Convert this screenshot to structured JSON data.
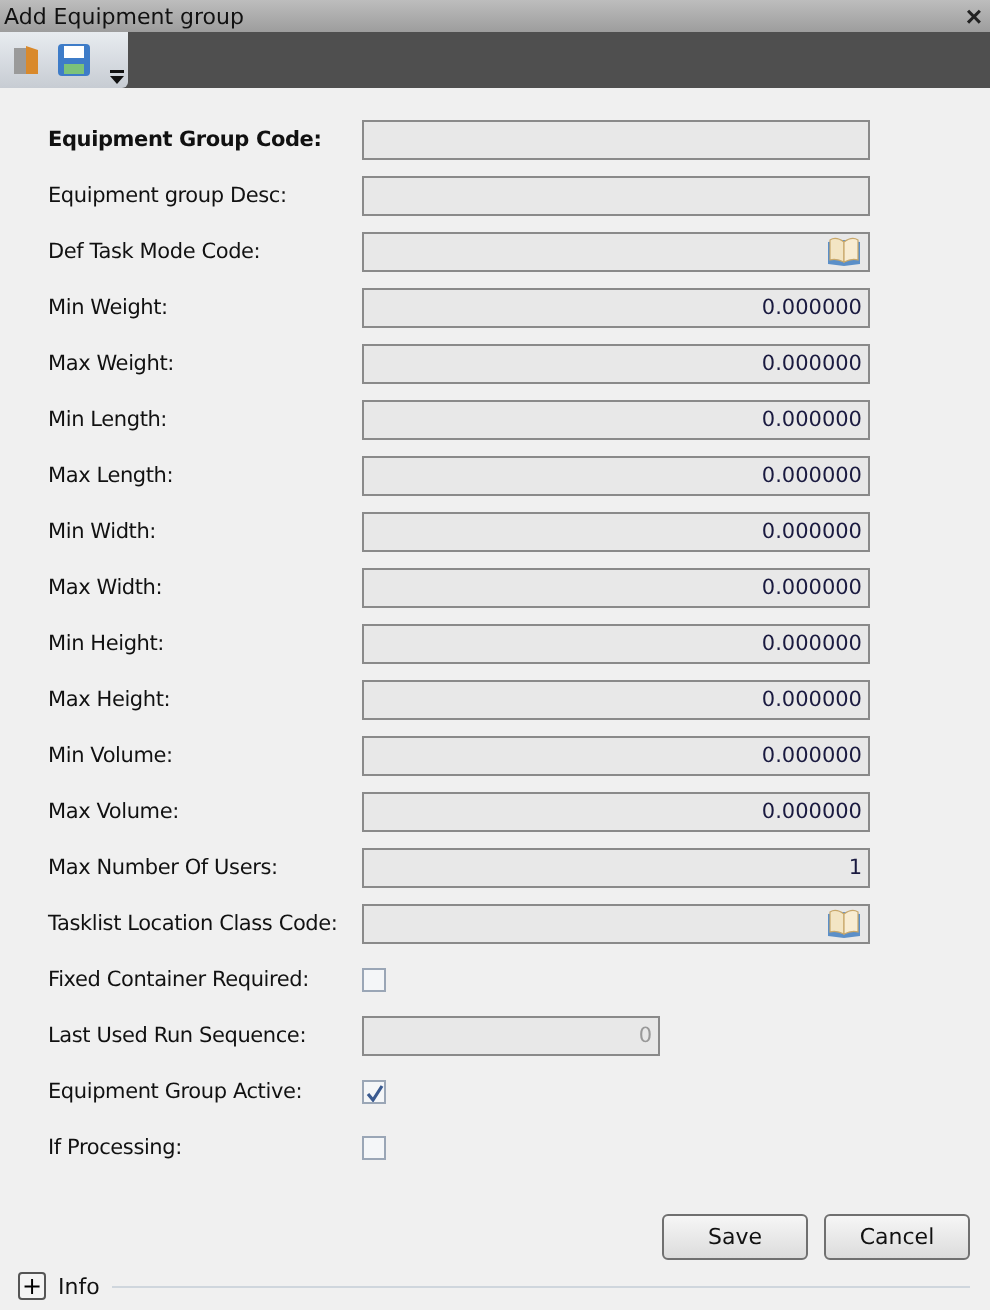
{
  "window": {
    "title": "Add Equipment group",
    "close": "×"
  },
  "fields": [
    {
      "label": "Equipment Group Code:",
      "required": true,
      "kind": "text"
    },
    {
      "label": "Equipment group Desc:",
      "required": false,
      "kind": "text"
    },
    {
      "label": "Def Task Mode Code:",
      "required": false,
      "kind": "lookup"
    },
    {
      "label": "Min Weight:",
      "required": false,
      "kind": "number",
      "value": "0.000000"
    },
    {
      "label": "Max Weight:",
      "required": false,
      "kind": "number",
      "value": "0.000000"
    },
    {
      "label": "Min Length:",
      "required": false,
      "kind": "number",
      "value": "0.000000"
    },
    {
      "label": "Max Length:",
      "required": false,
      "kind": "number",
      "value": "0.000000"
    },
    {
      "label": "Min Width:",
      "required": false,
      "kind": "number",
      "value": "0.000000"
    },
    {
      "label": "Max Width:",
      "required": false,
      "kind": "number",
      "value": "0.000000"
    },
    {
      "label": "Min Height:",
      "required": false,
      "kind": "number",
      "value": "0.000000"
    },
    {
      "label": "Max Height:",
      "required": false,
      "kind": "number",
      "value": "0.000000"
    },
    {
      "label": "Min Volume:",
      "required": false,
      "kind": "number",
      "value": "0.000000"
    },
    {
      "label": "Max Volume:",
      "required": false,
      "kind": "number",
      "value": "0.000000"
    },
    {
      "label": "Max Number Of Users:",
      "required": false,
      "kind": "number",
      "value": "1"
    },
    {
      "label": "Tasklist Location Class Code:",
      "required": false,
      "kind": "lookup"
    },
    {
      "label": "Fixed Container Required:",
      "required": false,
      "kind": "checkbox",
      "checked": false
    },
    {
      "label": "Last Used Run Sequence:",
      "required": false,
      "kind": "short",
      "value": "0"
    },
    {
      "label": "Equipment Group Active:",
      "required": false,
      "kind": "checkbox",
      "checked": true
    },
    {
      "label": "If Processing:",
      "required": false,
      "kind": "checkbox",
      "checked": false
    }
  ],
  "buttons": [
    "Save",
    "Cancel"
  ],
  "info": {
    "expander": "+",
    "label": "Info"
  }
}
